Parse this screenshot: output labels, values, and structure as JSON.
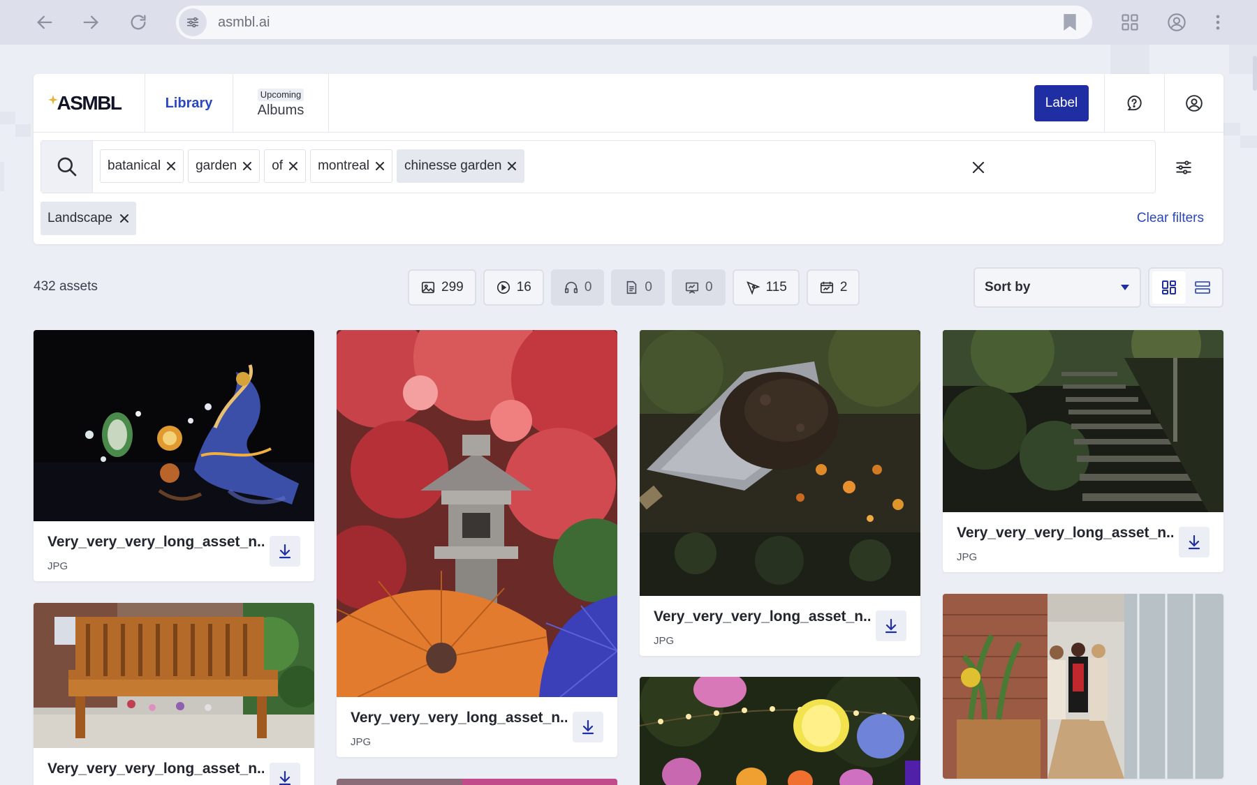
{
  "browser": {
    "url": "asmbl.ai",
    "back_icon": "arrow-left-icon",
    "forward_icon": "arrow-right-icon",
    "reload_icon": "reload-icon"
  },
  "header": {
    "logo": "ASMBL",
    "tabs": {
      "library": "Library",
      "albums_badge": "Upcoming",
      "albums": "Albums"
    },
    "label_button": "Label"
  },
  "search": {
    "chips": [
      "batanical",
      "garden",
      "of",
      "montreal",
      "chinesse garden"
    ],
    "filter_chip": "Landscape",
    "clear_filters": "Clear filters"
  },
  "toolbar": {
    "asset_count": "432 assets",
    "type_filters": [
      {
        "icon": "image-icon",
        "count": "299"
      },
      {
        "icon": "video-icon",
        "count": "16"
      },
      {
        "icon": "audio-icon",
        "count": "0"
      },
      {
        "icon": "document-icon",
        "count": "0"
      },
      {
        "icon": "presentation-icon",
        "count": "0"
      },
      {
        "icon": "vector-icon",
        "count": "115"
      },
      {
        "icon": "template-icon",
        "count": "2"
      }
    ],
    "sort_label": "Sort by"
  },
  "assets": [
    {
      "name": "Very_very_very_long_asset_n...",
      "type": "JPG"
    },
    {
      "name": "Very_very_very_long_asset_n...",
      "type": "JPG"
    },
    {
      "name": "Very_very_very_long_asset_n...",
      "type": "JPG"
    },
    {
      "name": "Very_very_very_long_asset_n...",
      "type": "JPG"
    },
    {
      "name": "Very_very_very_long_asset_n...",
      "type": "JPG"
    }
  ],
  "colors": {
    "accent": "#1f2fa3",
    "link": "#2a47c0",
    "page_bg": "#eceef5"
  }
}
